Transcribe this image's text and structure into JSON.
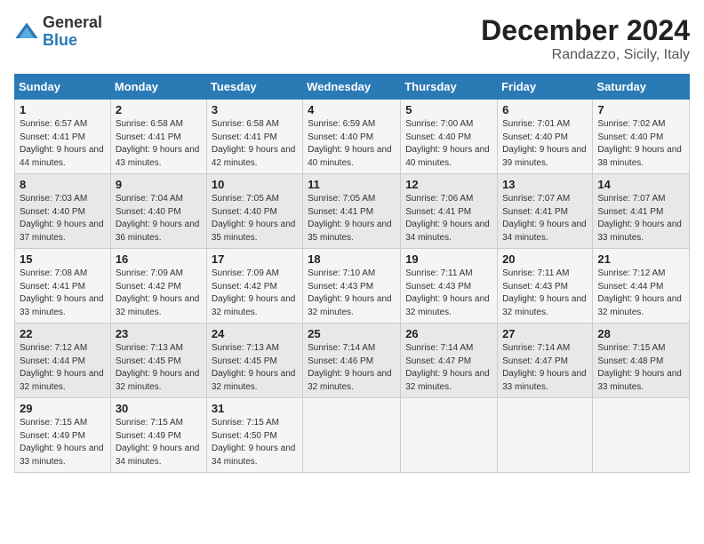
{
  "header": {
    "logo_general": "General",
    "logo_blue": "Blue",
    "month_title": "December 2024",
    "subtitle": "Randazzo, Sicily, Italy"
  },
  "calendar": {
    "days_of_week": [
      "Sunday",
      "Monday",
      "Tuesday",
      "Wednesday",
      "Thursday",
      "Friday",
      "Saturday"
    ],
    "weeks": [
      [
        null,
        null,
        null,
        null,
        null,
        null,
        null
      ]
    ],
    "cells": [
      {
        "day": null,
        "sunrise": null,
        "sunset": null,
        "daylight": null
      },
      {
        "day": null,
        "sunrise": null,
        "sunset": null,
        "daylight": null
      },
      {
        "day": null,
        "sunrise": null,
        "sunset": null,
        "daylight": null
      },
      {
        "day": null,
        "sunrise": null,
        "sunset": null,
        "daylight": null
      },
      {
        "day": null,
        "sunrise": null,
        "sunset": null,
        "daylight": null
      },
      {
        "day": null,
        "sunrise": null,
        "sunset": null,
        "daylight": null
      },
      {
        "day": null,
        "sunrise": null,
        "sunset": null,
        "daylight": null
      }
    ],
    "rows": [
      [
        {
          "day": "1",
          "sunrise": "Sunrise: 6:57 AM",
          "sunset": "Sunset: 4:41 PM",
          "daylight": "Daylight: 9 hours and 44 minutes."
        },
        {
          "day": "2",
          "sunrise": "Sunrise: 6:58 AM",
          "sunset": "Sunset: 4:41 PM",
          "daylight": "Daylight: 9 hours and 43 minutes."
        },
        {
          "day": "3",
          "sunrise": "Sunrise: 6:58 AM",
          "sunset": "Sunset: 4:41 PM",
          "daylight": "Daylight: 9 hours and 42 minutes."
        },
        {
          "day": "4",
          "sunrise": "Sunrise: 6:59 AM",
          "sunset": "Sunset: 4:40 PM",
          "daylight": "Daylight: 9 hours and 40 minutes."
        },
        {
          "day": "5",
          "sunrise": "Sunrise: 7:00 AM",
          "sunset": "Sunset: 4:40 PM",
          "daylight": "Daylight: 9 hours and 40 minutes."
        },
        {
          "day": "6",
          "sunrise": "Sunrise: 7:01 AM",
          "sunset": "Sunset: 4:40 PM",
          "daylight": "Daylight: 9 hours and 39 minutes."
        },
        {
          "day": "7",
          "sunrise": "Sunrise: 7:02 AM",
          "sunset": "Sunset: 4:40 PM",
          "daylight": "Daylight: 9 hours and 38 minutes."
        }
      ],
      [
        {
          "day": "8",
          "sunrise": "Sunrise: 7:03 AM",
          "sunset": "Sunset: 4:40 PM",
          "daylight": "Daylight: 9 hours and 37 minutes."
        },
        {
          "day": "9",
          "sunrise": "Sunrise: 7:04 AM",
          "sunset": "Sunset: 4:40 PM",
          "daylight": "Daylight: 9 hours and 36 minutes."
        },
        {
          "day": "10",
          "sunrise": "Sunrise: 7:05 AM",
          "sunset": "Sunset: 4:40 PM",
          "daylight": "Daylight: 9 hours and 35 minutes."
        },
        {
          "day": "11",
          "sunrise": "Sunrise: 7:05 AM",
          "sunset": "Sunset: 4:41 PM",
          "daylight": "Daylight: 9 hours and 35 minutes."
        },
        {
          "day": "12",
          "sunrise": "Sunrise: 7:06 AM",
          "sunset": "Sunset: 4:41 PM",
          "daylight": "Daylight: 9 hours and 34 minutes."
        },
        {
          "day": "13",
          "sunrise": "Sunrise: 7:07 AM",
          "sunset": "Sunset: 4:41 PM",
          "daylight": "Daylight: 9 hours and 34 minutes."
        },
        {
          "day": "14",
          "sunrise": "Sunrise: 7:07 AM",
          "sunset": "Sunset: 4:41 PM",
          "daylight": "Daylight: 9 hours and 33 minutes."
        }
      ],
      [
        {
          "day": "15",
          "sunrise": "Sunrise: 7:08 AM",
          "sunset": "Sunset: 4:41 PM",
          "daylight": "Daylight: 9 hours and 33 minutes."
        },
        {
          "day": "16",
          "sunrise": "Sunrise: 7:09 AM",
          "sunset": "Sunset: 4:42 PM",
          "daylight": "Daylight: 9 hours and 32 minutes."
        },
        {
          "day": "17",
          "sunrise": "Sunrise: 7:09 AM",
          "sunset": "Sunset: 4:42 PM",
          "daylight": "Daylight: 9 hours and 32 minutes."
        },
        {
          "day": "18",
          "sunrise": "Sunrise: 7:10 AM",
          "sunset": "Sunset: 4:43 PM",
          "daylight": "Daylight: 9 hours and 32 minutes."
        },
        {
          "day": "19",
          "sunrise": "Sunrise: 7:11 AM",
          "sunset": "Sunset: 4:43 PM",
          "daylight": "Daylight: 9 hours and 32 minutes."
        },
        {
          "day": "20",
          "sunrise": "Sunrise: 7:11 AM",
          "sunset": "Sunset: 4:43 PM",
          "daylight": "Daylight: 9 hours and 32 minutes."
        },
        {
          "day": "21",
          "sunrise": "Sunrise: 7:12 AM",
          "sunset": "Sunset: 4:44 PM",
          "daylight": "Daylight: 9 hours and 32 minutes."
        }
      ],
      [
        {
          "day": "22",
          "sunrise": "Sunrise: 7:12 AM",
          "sunset": "Sunset: 4:44 PM",
          "daylight": "Daylight: 9 hours and 32 minutes."
        },
        {
          "day": "23",
          "sunrise": "Sunrise: 7:13 AM",
          "sunset": "Sunset: 4:45 PM",
          "daylight": "Daylight: 9 hours and 32 minutes."
        },
        {
          "day": "24",
          "sunrise": "Sunrise: 7:13 AM",
          "sunset": "Sunset: 4:45 PM",
          "daylight": "Daylight: 9 hours and 32 minutes."
        },
        {
          "day": "25",
          "sunrise": "Sunrise: 7:14 AM",
          "sunset": "Sunset: 4:46 PM",
          "daylight": "Daylight: 9 hours and 32 minutes."
        },
        {
          "day": "26",
          "sunrise": "Sunrise: 7:14 AM",
          "sunset": "Sunset: 4:47 PM",
          "daylight": "Daylight: 9 hours and 32 minutes."
        },
        {
          "day": "27",
          "sunrise": "Sunrise: 7:14 AM",
          "sunset": "Sunset: 4:47 PM",
          "daylight": "Daylight: 9 hours and 33 minutes."
        },
        {
          "day": "28",
          "sunrise": "Sunrise: 7:15 AM",
          "sunset": "Sunset: 4:48 PM",
          "daylight": "Daylight: 9 hours and 33 minutes."
        }
      ],
      [
        {
          "day": "29",
          "sunrise": "Sunrise: 7:15 AM",
          "sunset": "Sunset: 4:49 PM",
          "daylight": "Daylight: 9 hours and 33 minutes."
        },
        {
          "day": "30",
          "sunrise": "Sunrise: 7:15 AM",
          "sunset": "Sunset: 4:49 PM",
          "daylight": "Daylight: 9 hours and 34 minutes."
        },
        {
          "day": "31",
          "sunrise": "Sunrise: 7:15 AM",
          "sunset": "Sunset: 4:50 PM",
          "daylight": "Daylight: 9 hours and 34 minutes."
        },
        null,
        null,
        null,
        null
      ]
    ]
  }
}
